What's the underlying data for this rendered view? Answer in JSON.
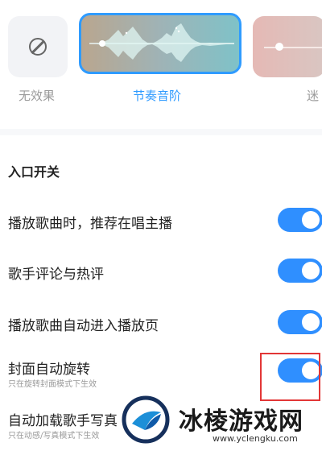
{
  "effects": [
    {
      "label": "无效果",
      "icon": "no-effect-icon",
      "selected": false
    },
    {
      "label": "节奏音阶",
      "icon": "waveform-icon",
      "selected": true
    },
    {
      "label": "迷",
      "icon": "slider-icon",
      "selected": false
    }
  ],
  "colors": {
    "accent": "#2f9bff",
    "toggle_on": "#2f8fff",
    "highlight": "#e23636"
  },
  "section": {
    "title": "入口开关",
    "rows": [
      {
        "title": "播放歌曲时，推荐在唱主播",
        "subtitle": "",
        "on": true
      },
      {
        "title": "歌手评论与热评",
        "subtitle": "",
        "on": true
      },
      {
        "title": "播放歌曲自动进入播放页",
        "subtitle": "",
        "on": true
      },
      {
        "title": "封面自动旋转",
        "subtitle": "只在旋转封面模式下生效",
        "on": true
      },
      {
        "title": "自动加载歌手写真",
        "subtitle": "只在动感/写真模式下生效",
        "on": true
      }
    ]
  },
  "watermark": {
    "title": "冰棱游戏网",
    "url": "www.yclengku.com"
  }
}
